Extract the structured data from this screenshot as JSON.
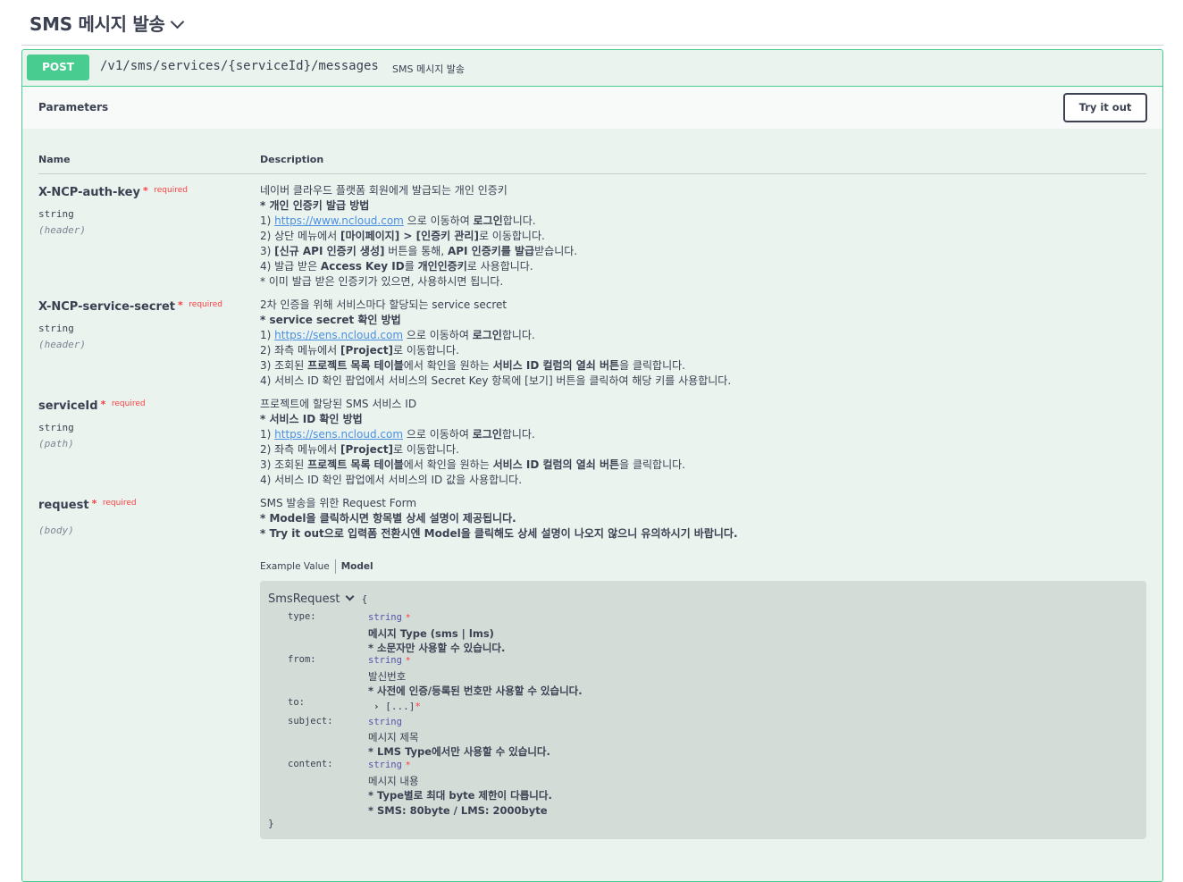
{
  "section": {
    "title": "SMS 메시지 발송"
  },
  "operation": {
    "method": "POST",
    "path": "/v1/sms/services/{serviceId}/messages",
    "summary": "SMS 메시지 발송"
  },
  "params_header": {
    "title": "Parameters",
    "try_label": "Try it out"
  },
  "columns": {
    "name": "Name",
    "description": "Description"
  },
  "required_label": "required",
  "params": [
    {
      "name": "X-NCP-auth-key",
      "type": "string",
      "in": "(header)",
      "desc": [
        "네이버 클라우드 플랫폼 회원에게 발급되는 개인 인증키",
        "* 개인 인증키 발급 방법",
        "1) https://www.ncloud.com 으로 이동하여 로그인합니다.",
        "2) 상단 메뉴에서 [마이페이지] > [인증키 관리]로 이동합니다.",
        "3) [신규 API 인증키 생성] 버튼을 통해, API 인증키를 발급받습니다.",
        "4) 발급 받은 Access Key ID를 개인인증키로 사용합니다.",
        "* 이미 발급 받은 인증키가 있으면, 사용하시면 됩니다."
      ]
    },
    {
      "name": "X-NCP-service-secret",
      "type": "string",
      "in": "(header)",
      "desc": [
        "2차 인증을 위해 서비스마다 할당되는 service secret",
        "* service secret 확인 방법",
        "1) https://sens.ncloud.com 으로 이동하여 로그인합니다.",
        "2) 좌측 메뉴에서 [Project]로 이동합니다.",
        "3) 조회된 프로젝트 목록 테이블에서 확인을 원하는 서비스 ID 컬럼의 열쇠 버튼을 클릭합니다.",
        "4) 서비스 ID 확인 팝업에서 서비스의 Secret Key 항목에 [보기] 버튼을 클릭하여 해당 키를 사용합니다."
      ]
    },
    {
      "name": "serviceId",
      "type": "string",
      "in": "(path)",
      "desc": [
        "프로젝트에 할당된 SMS 서비스 ID",
        "* 서비스 ID 확인 방법",
        "1) https://sens.ncloud.com 으로 이동하여 로그인합니다.",
        "2) 좌측 메뉴에서 [Project]로 이동합니다.",
        "3) 조회된 프로젝트 목록 테이블에서 확인을 원하는 서비스 ID 컬럼의 열쇠 버튼을 클릭합니다.",
        "4) 서비스 ID 확인 팝업에서 서비스의 ID 값을 사용합니다."
      ]
    },
    {
      "name": "request",
      "type": "",
      "in": "(body)",
      "desc": [
        "SMS 발송을 위한 Request Form",
        "* Model을 클릭하시면 항목별 상세 설명이 제공됩니다.",
        "* Try it out으로 입력폼 전환시엔 Model을 클릭해도 상세 설명이 나오지 않으니 유의하시기 바랍니다."
      ]
    }
  ],
  "tabs": {
    "example": "Example Value",
    "model": "Model"
  },
  "model": {
    "title": "SmsRequest",
    "open": "{",
    "close": "}",
    "props": [
      {
        "key": "type:",
        "type": "string",
        "lines": [
          "메시지 Type (sms | lms)",
          "* 소문자만 사용할 수 있습니다."
        ]
      },
      {
        "key": "from:",
        "type": "string",
        "lines": [
          "발신번호",
          "* 사전에 인증/등록된 번호만 사용할 수 있습니다."
        ]
      },
      {
        "key": "to:",
        "array": "[...]"
      },
      {
        "key": "subject:",
        "type": "string",
        "lines": [
          "메시지 제목",
          "* LMS Type에서만 사용할 수 있습니다."
        ]
      },
      {
        "key": "content:",
        "type": "string",
        "lines": [
          "메시지 내용",
          "* Type별로 최대 byte 제한이 다릅니다.",
          "* SMS: 80byte / LMS: 2000byte"
        ]
      }
    ],
    "star": "*"
  }
}
